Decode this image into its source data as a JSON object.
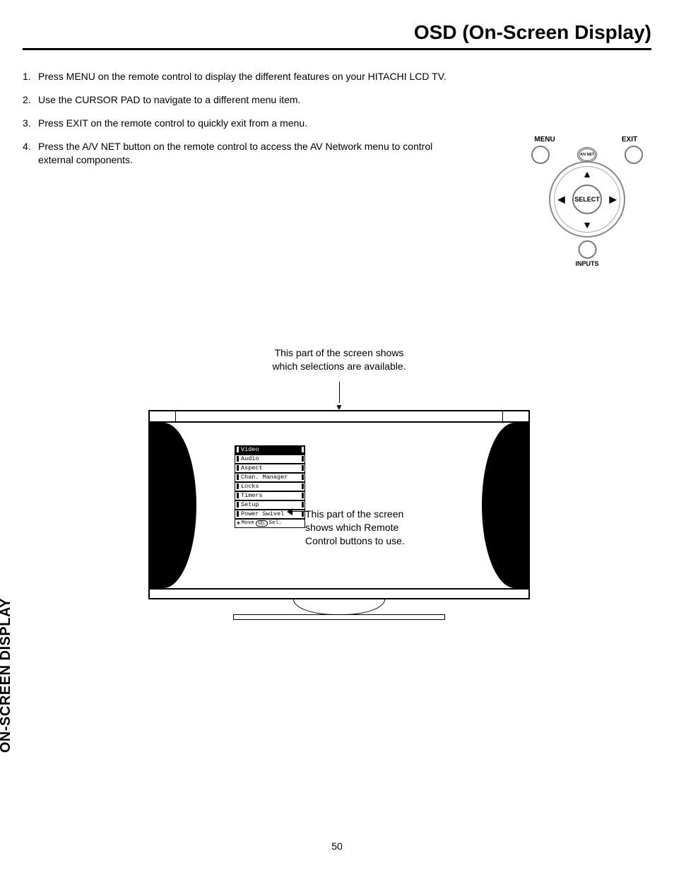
{
  "header": {
    "title": "OSD (On-Screen Display)"
  },
  "instructions": [
    {
      "num": "1.",
      "text": "Press MENU on the remote control to display the different features on your HITACHI LCD TV."
    },
    {
      "num": "2.",
      "text": "Use the CURSOR PAD to navigate to a different menu item."
    },
    {
      "num": "3.",
      "text": "Press EXIT on the remote control to quickly exit from a menu."
    },
    {
      "num": "4.",
      "text": "Press the A/V NET button on the remote control to access the AV Network menu to control external components."
    }
  ],
  "remote": {
    "menu_label": "MENU",
    "avnet_label": "A/V NET",
    "exit_label": "EXIT",
    "select_label": "SELECT",
    "inputs_label": "INPUTS"
  },
  "tv": {
    "caption_top_line1": "This part of the screen shows",
    "caption_top_line2": "which selections are available.",
    "caption_side_line1": "This part of the screen",
    "caption_side_line2": "shows which Remote",
    "caption_side_line3": "Control buttons to use.",
    "menu_items": [
      {
        "label": "Video",
        "selected": true
      },
      {
        "label": "Audio",
        "selected": false
      },
      {
        "label": "Aspect",
        "selected": false
      },
      {
        "label": "Chan. Manager",
        "selected": false
      },
      {
        "label": "Locks",
        "selected": false
      },
      {
        "label": "Timers",
        "selected": false
      },
      {
        "label": "Setup",
        "selected": false
      },
      {
        "label": "Power Swivel",
        "selected": false
      }
    ],
    "nav_hint_move": "Move",
    "nav_hint_sel_icon": "SEL",
    "nav_hint_sel": "Sel."
  },
  "side_tab": "ON-SCREEN DISPLAY",
  "page_number": "50"
}
